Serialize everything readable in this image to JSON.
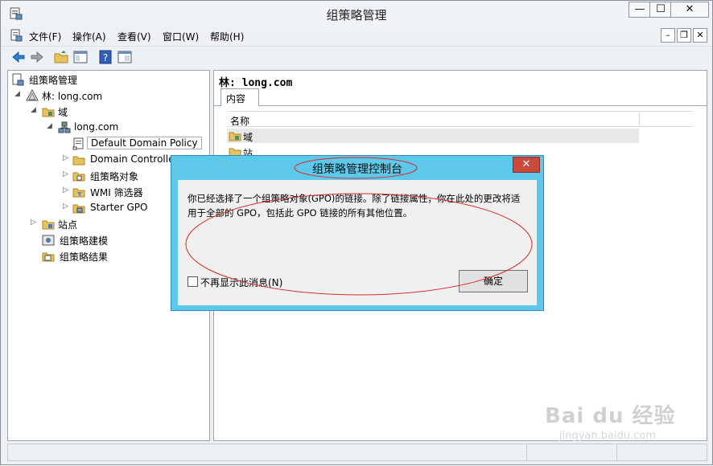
{
  "window": {
    "title": "组策略管理",
    "min_icon": "—",
    "max_icon": "☐",
    "close_icon": "✕"
  },
  "menu": {
    "items": [
      "文件(F)",
      "操作(A)",
      "查看(V)",
      "窗口(W)",
      "帮助(H)"
    ],
    "mdi_min": "–",
    "mdi_restore": "❐",
    "mdi_close": "✕"
  },
  "toolbar": {
    "icons": [
      "back-arrow-icon",
      "forward-arrow-icon",
      "up-folder-icon",
      "console-tree-icon",
      "help-icon",
      "properties-icon"
    ]
  },
  "tree": {
    "root": "组策略管理",
    "forest": "林: long.com",
    "domains": "域",
    "domain": "long.com",
    "items": [
      "Default Domain Policy",
      "Domain Controllers",
      "组策略对象",
      "WMI 筛选器",
      "Starter GPO"
    ],
    "sites": "站点",
    "modeling": "组策略建模",
    "results": "组策略结果"
  },
  "content": {
    "forest_title": "林: long.com",
    "tab": "内容",
    "column_name": "名称",
    "rows": [
      "域",
      "站点"
    ]
  },
  "dialog": {
    "title": "组策略管理控制台",
    "close_icon": "✕",
    "message": "你已经选择了一个组策略对象(GPO)的链接。除了链接属性，你在此处的更改将适用于全部的 GPO，包括此 GPO 链接的所有其他位置。",
    "checkbox_label": "不再显示此消息(N)",
    "checkbox_checked": false,
    "ok_label": "确定"
  },
  "annotation_color": "#d42a2a",
  "watermark": {
    "main": "Bai du 经验",
    "sub": "jingyan.baidu.com"
  }
}
